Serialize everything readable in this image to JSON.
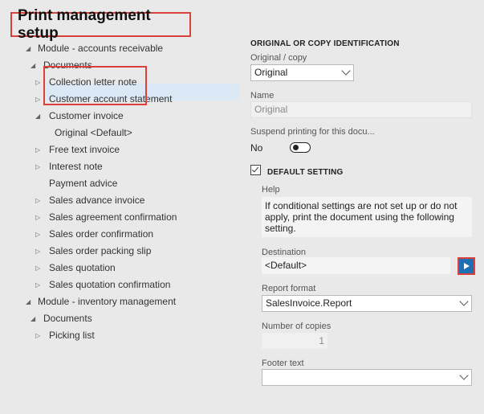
{
  "page": {
    "title": "Print management setup"
  },
  "tree": {
    "items": [
      {
        "label": "Module - accounts receivable",
        "arrow": "◢"
      },
      {
        "label": "Documents",
        "arrow": "◢"
      },
      {
        "label": "Collection letter note",
        "arrow": "▷"
      },
      {
        "label": "Customer account statement",
        "arrow": "▷"
      },
      {
        "label": "Customer invoice",
        "arrow": "◢"
      },
      {
        "label": "Original <Default>",
        "arrow": ""
      },
      {
        "label": "Free text invoice",
        "arrow": "▷"
      },
      {
        "label": "Interest note",
        "arrow": "▷"
      },
      {
        "label": "Payment advice",
        "arrow": ""
      },
      {
        "label": "Sales advance invoice",
        "arrow": "▷"
      },
      {
        "label": "Sales agreement confirmation",
        "arrow": "▷"
      },
      {
        "label": "Sales order confirmation",
        "arrow": "▷"
      },
      {
        "label": "Sales order packing slip",
        "arrow": "▷"
      },
      {
        "label": "Sales quotation",
        "arrow": "▷"
      },
      {
        "label": "Sales quotation confirmation",
        "arrow": "▷"
      },
      {
        "label": "Module - inventory management",
        "arrow": "◢"
      },
      {
        "label": "Documents",
        "arrow": "◢"
      },
      {
        "label": "Picking list",
        "arrow": "▷"
      }
    ]
  },
  "form": {
    "section_title": "ORIGINAL OR COPY IDENTIFICATION",
    "original_copy_label": "Original / copy",
    "original_copy_value": "Original",
    "name_label": "Name",
    "name_value": "Original",
    "suspend_label": "Suspend printing for this docu...",
    "suspend_value": "No",
    "default_setting_label": "DEFAULT SETTING",
    "help_label": "Help",
    "help_text": "If conditional settings are not set up or do not apply, print the document using the following setting.",
    "destination_label": "Destination",
    "destination_value": "<Default>",
    "report_format_label": "Report format",
    "report_format_value": "SalesInvoice.Report",
    "copies_label": "Number of copies",
    "copies_value": "1",
    "footer_label": "Footer text",
    "footer_value": ""
  },
  "colors": {
    "highlight": "#d9413a",
    "accent": "#1f6fb5",
    "selection": "#dbe8f5"
  }
}
